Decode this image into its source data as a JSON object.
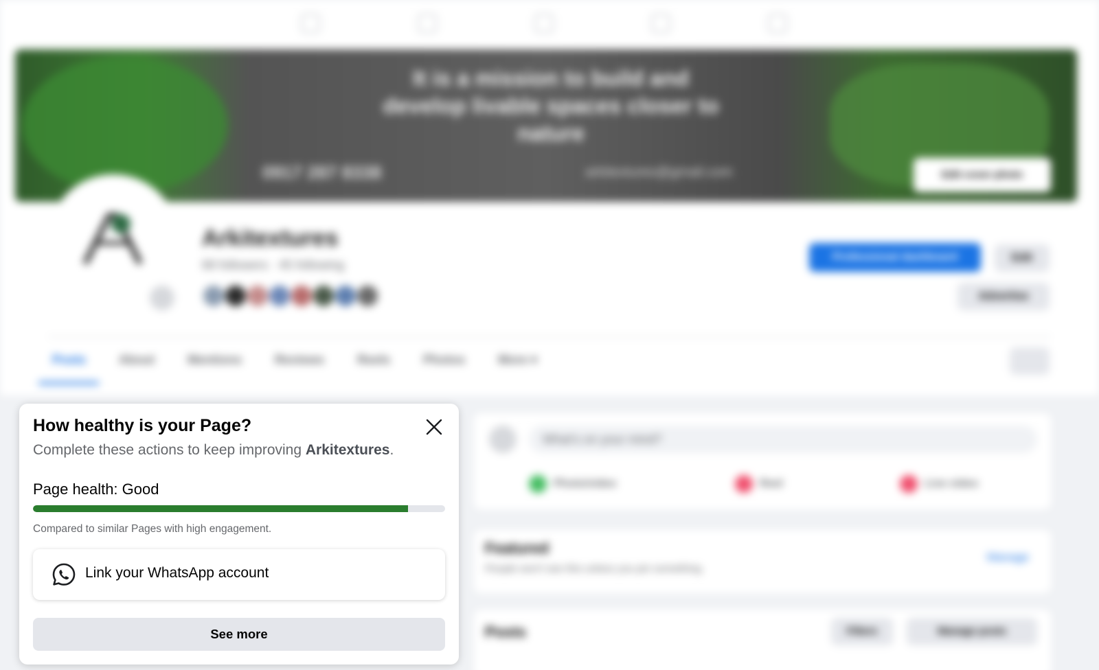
{
  "topnav": {
    "icons": [
      "home-icon",
      "watch-icon",
      "marketplace-icon",
      "groups-icon",
      "gaming-icon"
    ]
  },
  "cover": {
    "headline": "It is a mission to build and develop livable spaces closer to nature",
    "phone": "0917 287 8338",
    "email": "arkitextures@gmail.com",
    "edit_cover_label": "Edit cover photo"
  },
  "profile": {
    "page_name": "Arkitextures",
    "meta": "68 followers · 45 following",
    "primary_button": "Professional dashboard",
    "edit_button": "Edit",
    "secondary_button": "Advertise"
  },
  "tabs": {
    "items": [
      "Posts",
      "About",
      "Mentions",
      "Reviews",
      "Reels",
      "Photos",
      "More ▾"
    ]
  },
  "composer": {
    "placeholder": "What's on your mind?",
    "photo": "Photo/video",
    "reel": "Reel",
    "live": "Live video"
  },
  "featured": {
    "title": "Featured",
    "subtitle": "People won't see this unless you pin something.",
    "manage": "Manage"
  },
  "posts": {
    "title": "Posts",
    "filters": "Filters",
    "manage": "Manage posts"
  },
  "health": {
    "title": "How healthy is your Page?",
    "subtitle_prefix": "Complete these actions to keep improving ",
    "page_name": "Arkitextures",
    "subtitle_suffix": ".",
    "status": "Page health: Good",
    "progress": 0.91,
    "note": "Compared to similar Pages with high engagement.",
    "whatsapp_label": "Link your WhatsApp account",
    "see_more": "See more"
  },
  "colors": {
    "accent": "#1b74e4",
    "health_good": "#2a7d2e",
    "surface": "#ffffff",
    "background": "#f0f2f5"
  }
}
